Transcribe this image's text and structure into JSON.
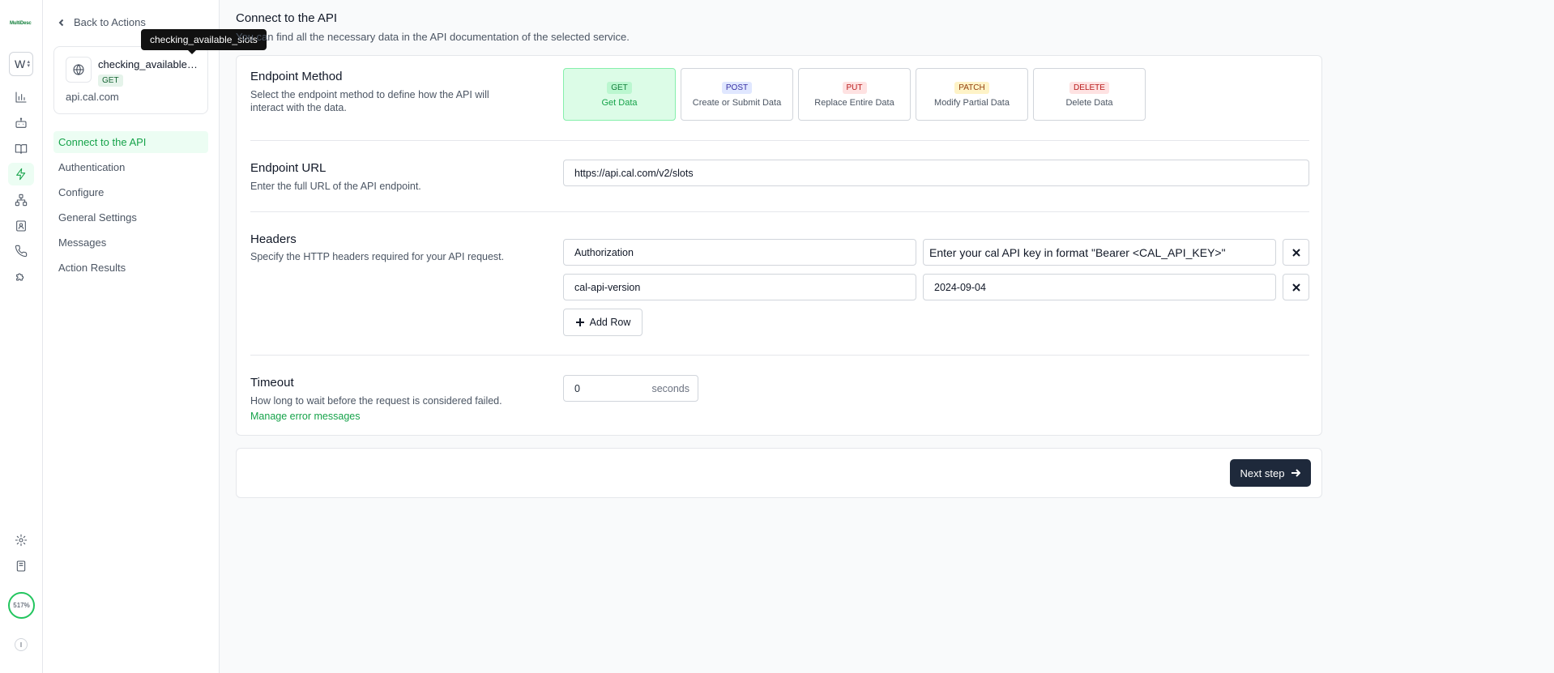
{
  "rail": {
    "logo_text": "MultiDesc",
    "workspace_initial": "W",
    "usage_percent": "517%",
    "user_initial": "I",
    "icons": [
      "bar-chart-icon",
      "bot-icon",
      "book-icon",
      "lightning-icon",
      "network-icon",
      "contacts-icon",
      "phone-icon",
      "puzzle-icon",
      "gear-icon",
      "notebook-icon"
    ],
    "active_icon": "lightning-icon",
    "accent_color": "#16a34a"
  },
  "sidebar": {
    "back_label": "Back to Actions",
    "tooltip": "checking_available_slots",
    "action": {
      "name": "checking_available_slots",
      "method_badge": "GET",
      "domain": "api.cal.com"
    },
    "nav": [
      {
        "label": "Connect to the API",
        "active": true
      },
      {
        "label": "Authentication",
        "active": false
      },
      {
        "label": "Configure",
        "active": false
      },
      {
        "label": "General Settings",
        "active": false
      },
      {
        "label": "Messages",
        "active": false
      },
      {
        "label": "Action Results",
        "active": false
      }
    ]
  },
  "main": {
    "title": "Connect to the API",
    "subtitle": "You can find all the necessary data in the API documentation of the selected service.",
    "endpoint_method": {
      "title": "Endpoint Method",
      "description": "Select the endpoint method to define how the API will interact with the data.",
      "selected": "GET",
      "options": [
        {
          "tag": "GET",
          "label": "Get Data",
          "tag_bg": "#bbf7d0",
          "tag_color": "#15803d"
        },
        {
          "tag": "POST",
          "label": "Create or Submit Data",
          "tag_bg": "#e0e7ff",
          "tag_color": "#3730a3"
        },
        {
          "tag": "PUT",
          "label": "Replace Entire Data",
          "tag_bg": "#fee2e2",
          "tag_color": "#b91c1c"
        },
        {
          "tag": "PATCH",
          "label": "Modify Partial Data",
          "tag_bg": "#fef3c7",
          "tag_color": "#92400e"
        },
        {
          "tag": "DELETE",
          "label": "Delete Data",
          "tag_bg": "#fee2e2",
          "tag_color": "#b91c1c"
        }
      ]
    },
    "endpoint_url": {
      "title": "Endpoint URL",
      "description": "Enter the full URL of the API endpoint.",
      "value": "https://api.cal.com/v2/slots"
    },
    "headers": {
      "title": "Headers",
      "description": "Specify the HTTP headers required for your API request.",
      "rows": [
        {
          "key": "Authorization",
          "value": "Enter your cal API key in format \"Bearer <CAL_API_KEY>\""
        },
        {
          "key": "cal-api-version",
          "value": "2024-09-04"
        }
      ],
      "add_row_label": "Add Row"
    },
    "timeout": {
      "title": "Timeout",
      "description": "How long to wait before the request is considered failed.",
      "value": "0",
      "unit": "seconds",
      "error_link": "Manage error messages"
    },
    "next_label": "Next step"
  }
}
